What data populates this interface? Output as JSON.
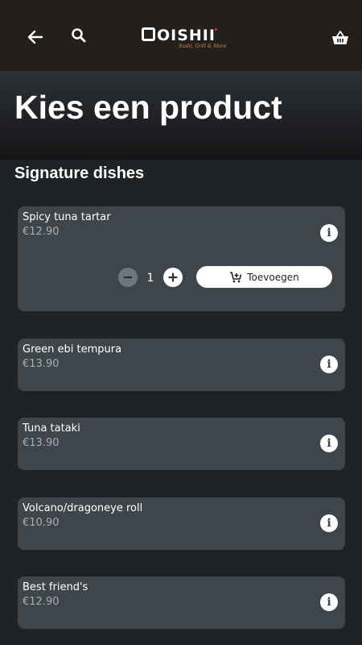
{
  "header": {
    "logo_text": "OISHII",
    "logo_tagline": "Sushi, Grill & More"
  },
  "page": {
    "title": "Kies een product",
    "section": "Signature dishes"
  },
  "expanded_item": {
    "quantity": "1",
    "add_label": "Toevoegen"
  },
  "products": [
    {
      "name": "Spicy tuna tartar",
      "price": "€12.90"
    },
    {
      "name": "Green ebi tempura",
      "price": "€13.90"
    },
    {
      "name": "Tuna tataki",
      "price": "€13.90"
    },
    {
      "name": "Volcano/dragoneye roll",
      "price": "€10.90"
    },
    {
      "name": "Best friend's",
      "price": "€12.90"
    }
  ],
  "icons": {
    "back": "arrow-left-icon",
    "search": "search-icon",
    "cart": "basket-icon",
    "info": "info-icon",
    "minus": "minus-icon",
    "plus": "plus-icon",
    "add_to_cart": "cart-plus-icon"
  },
  "colors": {
    "header_bg": "#231f1c",
    "card_bg": "#3f464b",
    "page_bg": "#202326",
    "price_text": "#a8adb1",
    "logo_accent": "#d98a3a"
  }
}
